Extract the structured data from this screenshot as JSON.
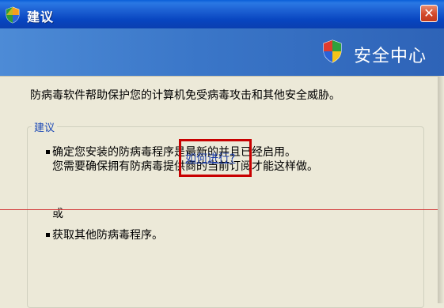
{
  "window": {
    "title": "建议",
    "close_glyph": "✕",
    "title_icon": "shield-icon",
    "close_icon": "close-icon"
  },
  "banner": {
    "text": "安全中心",
    "icon": "shield-icon"
  },
  "content": {
    "intro": "防病毒软件帮助保护您的计算机免受病毒攻击和其他安全威胁。",
    "group_title": "建议",
    "bullet1_line1": "确定您安装的防病毒程序是最新的并且已经启用。",
    "bullet1_line2": "您需要确保拥有防病毒提供商的当前订阅才能这样做。",
    "or_text": "或",
    "bullet2_text": "获取其他防病毒程序。",
    "bullet2_link": "如何进行?"
  },
  "colors": {
    "titlebar": "#0845c0",
    "banner": "#3a76c8",
    "group_title": "#1c49b6",
    "link": "#1d3ea8",
    "highlight_box": "#c80000",
    "close_button": "#d3492b"
  }
}
